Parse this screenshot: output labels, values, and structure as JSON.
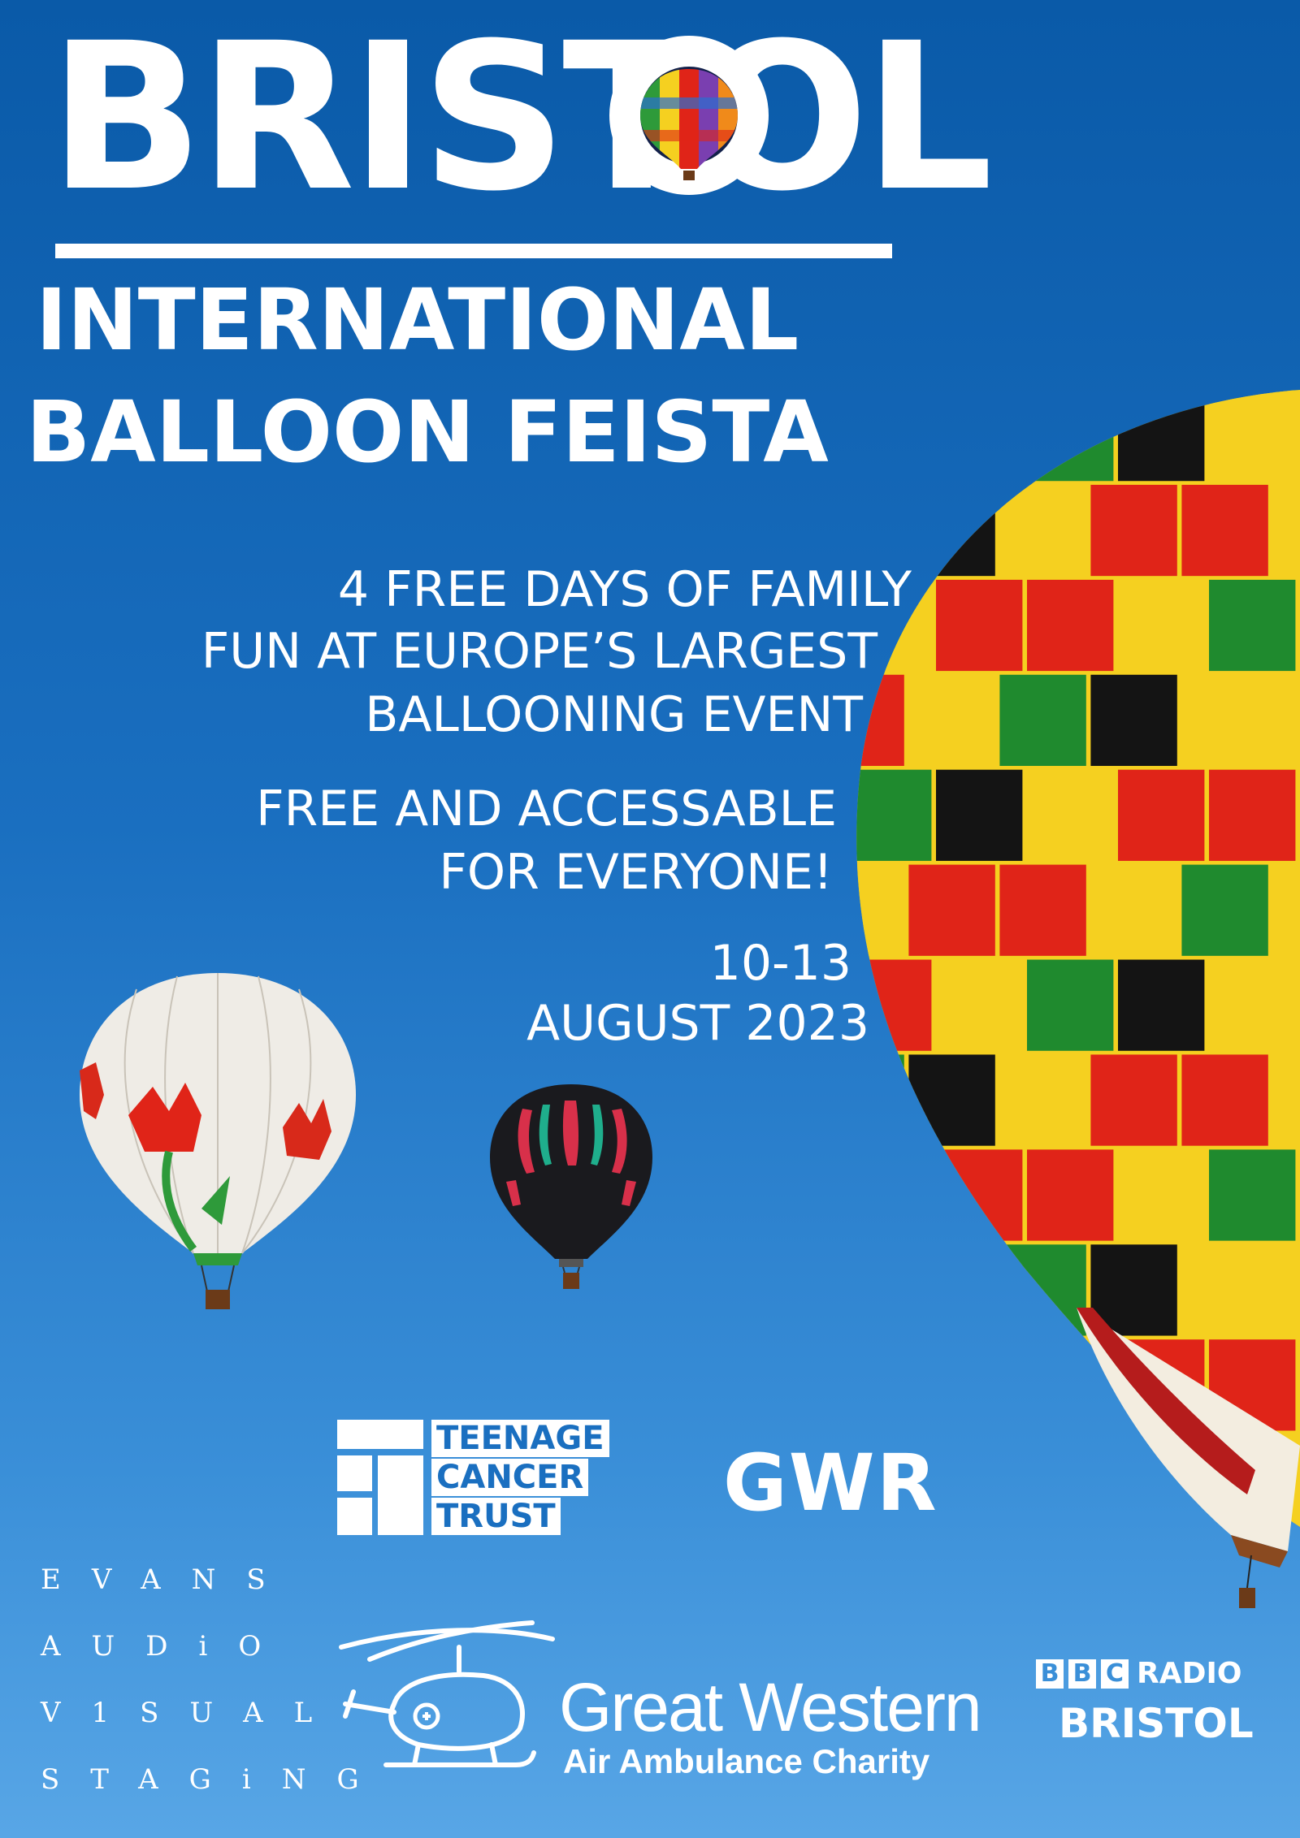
{
  "logo": {
    "text": "BRISTOL"
  },
  "headline": {
    "line1": "INTERNATIONAL",
    "line2": "BALLOON FEISTA"
  },
  "tagline": {
    "line1": "4 FREE DAYS OF FAMILY",
    "line2": "FUN AT EUROPE’S LARGEST",
    "line3": "BALLOONING EVENT",
    "line4": "FREE AND ACCESSABLE",
    "line5": "FOR EVERYONE!",
    "line6": "10-13",
    "line7": "AUGUST 2023"
  },
  "sponsors": {
    "tct": {
      "line1": "TEENAGE",
      "line2": "CANCER",
      "line3": "TRUST"
    },
    "gwr": {
      "text": "GWR"
    },
    "evans": {
      "line1": "EVANS",
      "line2": "AUDiO",
      "line3": "V1SUAL",
      "line4": "STAGiNG"
    },
    "gwaa": {
      "line1": "Great Western",
      "line2": "Air Ambulance Charity"
    },
    "bbc": {
      "b1": "B",
      "b2": "B",
      "b3": "C",
      "radio": "RADIO",
      "station": "BRISTOL"
    }
  },
  "colors": {
    "sky_top": "#0a5aa8",
    "sky_bottom": "#58a6e6",
    "red": "#e02418",
    "yellow": "#f5d020",
    "green": "#1f8a2e",
    "black": "#141414"
  },
  "icons": [
    "balloon-icon",
    "teenage-cancer-trust-logo-icon",
    "helicopter-icon"
  ]
}
